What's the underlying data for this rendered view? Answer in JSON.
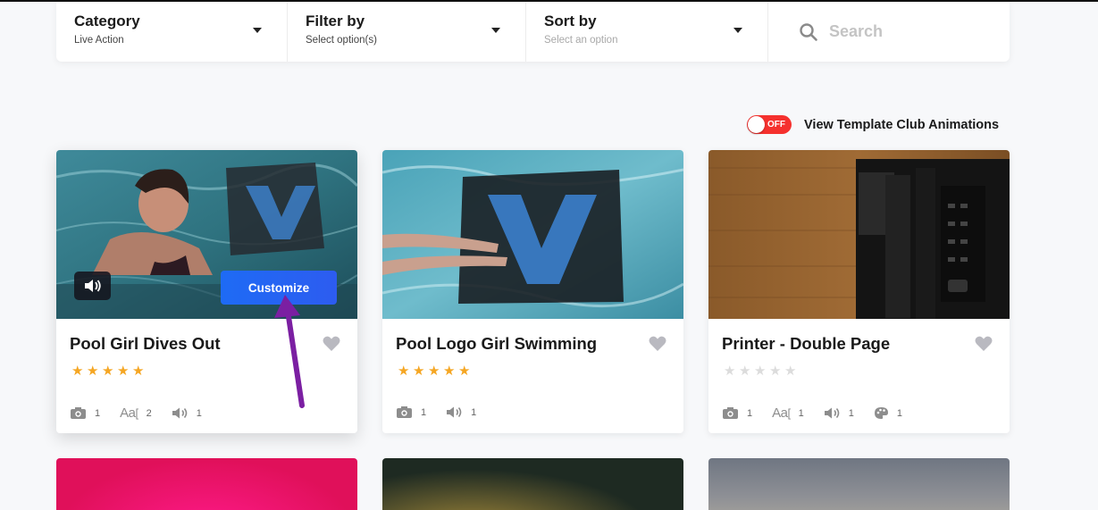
{
  "filters": {
    "category": {
      "title": "Category",
      "value": "Live Action"
    },
    "filter_by": {
      "title": "Filter by",
      "value": "Select option(s)"
    },
    "sort_by": {
      "title": "Sort by",
      "placeholder": "Select an option"
    },
    "search": {
      "placeholder": "Search"
    }
  },
  "toggle": {
    "state": "OFF",
    "label": "View Template Club Animations",
    "color": "#f5312e"
  },
  "cards": [
    {
      "title": "Pool Girl Dives Out",
      "rating": 5,
      "customize_label": "Customize",
      "meta": {
        "images": "1",
        "text": "2",
        "audio": "1"
      }
    },
    {
      "title": "Pool Logo Girl Swimming",
      "rating": 5,
      "meta": {
        "images": "1",
        "audio": "1"
      }
    },
    {
      "title": "Printer - Double Page",
      "rating": 0,
      "meta": {
        "images": "1",
        "text": "1",
        "audio": "1",
        "colors": "1"
      }
    }
  ],
  "colors": {
    "accent": "#1e6bf5",
    "star": "#f5a623",
    "star_empty": "#dcdcdc",
    "annotation_arrow": "#7b1fa2"
  }
}
